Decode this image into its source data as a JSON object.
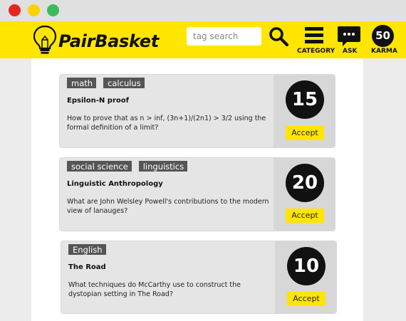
{
  "window": {
    "controls": [
      {
        "name": "close",
        "color": "#e82421"
      },
      {
        "name": "minimize",
        "color": "#f9d200"
      },
      {
        "name": "maximize",
        "color": "#3dbb5c"
      }
    ]
  },
  "brand": {
    "name": "PairBasket",
    "accent": "#ffe500"
  },
  "search": {
    "placeholder": "tag search",
    "value": ""
  },
  "nav": {
    "category_label": "CATEGORY",
    "ask_label": "ASK",
    "karma_value": "50",
    "karma_label": "KARMA"
  },
  "questions": [
    {
      "tags": [
        "math",
        "calculus"
      ],
      "title": "Epsilon-N proof",
      "body": "How to prove that as n > inf,  (3n+1)/(2n1) > 3/2 using the formal definition of a limit?",
      "score": "15",
      "accept_label": "Accept"
    },
    {
      "tags": [
        "social science",
        "linguistics"
      ],
      "title": "Linguistic Anthropology",
      "body": "What are John Welsley Powell's contributions to the modern view of lanauges?",
      "score": "20",
      "accept_label": "Accept"
    },
    {
      "tags": [
        "English"
      ],
      "title": "The Road",
      "body": "What techniques do McCarthy use to construct the dystopian setting in The Road?",
      "score": "10",
      "accept_label": "Accept"
    }
  ]
}
